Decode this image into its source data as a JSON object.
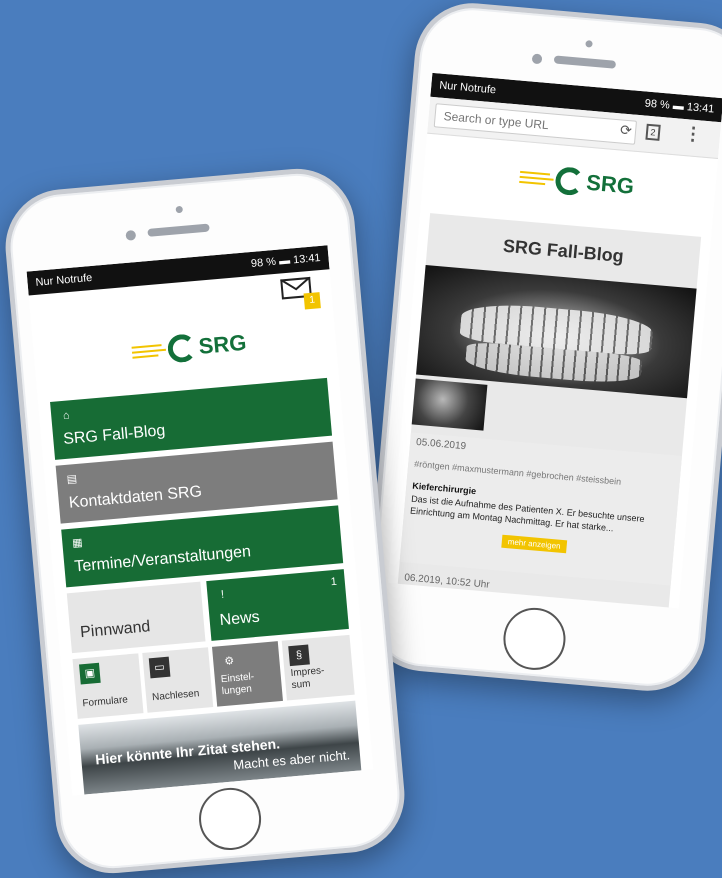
{
  "left_phone": {
    "status": {
      "carrier": "Nur Notrufe",
      "indicators": "98 %",
      "time": "13:41"
    },
    "mail_badge": "1",
    "logo_text": "SRG",
    "tiles": [
      {
        "label": "SRG Fall-Blog",
        "icon": "home-icon"
      },
      {
        "label": "Kontaktdaten SRG",
        "icon": "book-icon"
      },
      {
        "label": "Termine/Veranstaltungen",
        "icon": "calendar-icon"
      }
    ],
    "pinnwand": "Pinnwand",
    "news": {
      "label": "News",
      "badge": "1",
      "icon": "exclamation-icon"
    },
    "small_tiles": [
      {
        "label": "Formulare",
        "icon": "form-icon"
      },
      {
        "label": "Nachlesen",
        "icon": "chat-icon"
      },
      {
        "label": "Einstel-\nlungen",
        "icon": "gear-icon"
      },
      {
        "label": "Impres-\nsum",
        "icon": "paragraph-icon"
      }
    ],
    "quote": {
      "line1": "Hier könnte Ihr Zitat stehen.",
      "line2": "Macht es aber nicht."
    }
  },
  "right_phone": {
    "status": {
      "carrier": "Nur Notrufe",
      "indicators": "98 %",
      "time": "13:41"
    },
    "url_placeholder": "Search or type URL",
    "tabs_count": "2",
    "logo_text": "SRG",
    "blog_title": "SRG Fall-Blog",
    "post": {
      "date": "05.06.2019",
      "tags": "#röntgen #maxmustermann #gebrochen #steissbein",
      "title": "Kieferchirurgie",
      "text1": "Das ist die Aufnahme des Patienten X. Er besuchte unsere",
      "text2": "Einrichtung am Montag Nachmittag. Er hat starke...",
      "more": "mehr anzeigen"
    },
    "post2_date": "06.2019, 10:52 Uhr"
  },
  "colors": {
    "background": "#4a7dbe",
    "brand_green": "#176c35",
    "accent_yellow": "#f2c400"
  }
}
